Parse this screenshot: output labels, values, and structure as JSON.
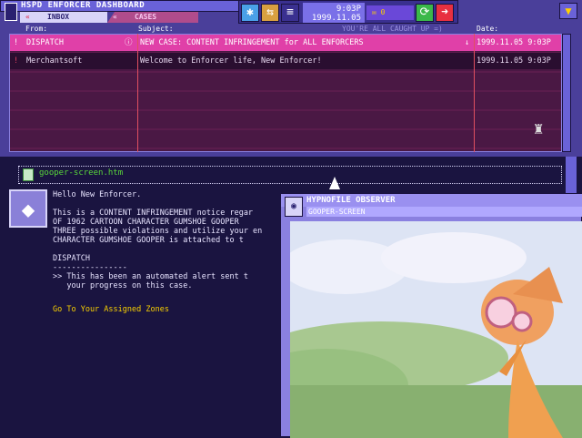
{
  "window": {
    "title": "HSPD ENFORCER DASHBOARD"
  },
  "tabs": [
    {
      "label": "INBOX"
    },
    {
      "label": "CASES"
    }
  ],
  "toolbar": {
    "time": "9:03P",
    "date": "1999.11.05",
    "unread_count": "0",
    "min_label": "▼"
  },
  "inbox": {
    "headers": {
      "from": "From:",
      "subject": "Subject:",
      "status": "YOU'RE ALL CAUGHT UP =)",
      "date": "Date:"
    },
    "rows": [
      {
        "from": "DISPATCH",
        "subject": "NEW CASE: CONTENT INFRINGEMENT for ALL ENFORCERS",
        "date": "1999.11.05  9:03P"
      },
      {
        "from": "Merchantsoft",
        "subject": "Welcome to Enforcer life, New Enforcer!",
        "date": "1999.11.05  9:03P"
      }
    ]
  },
  "message": {
    "attachment": "gooper-screen.htm",
    "greeting": "Hello New Enforcer.",
    "line1": "This is a CONTENT INFRINGEMENT notice regar",
    "line2": "OF 1962 CARTOON CHARACTER GUMSHOE GOOPER",
    "line3": "THREE possible violations and utilize your en",
    "line4": "CHARACTER GUMSHOE GOOPER is attached to t",
    "signature": "DISPATCH",
    "rule": "----------------",
    "note1": ">> This has been an automated alert sent t",
    "note2": "   your progress on this case.",
    "link": "Go To Your Assigned Zones"
  },
  "observer": {
    "title": "HYPNOFILE OBSERVER",
    "subtitle": "GOOPER-SCREEN"
  },
  "colors": {
    "accent": "#e040a8",
    "panel": "#4a3f9a",
    "highlight": "#5ad83a",
    "link": "#f8d000"
  }
}
